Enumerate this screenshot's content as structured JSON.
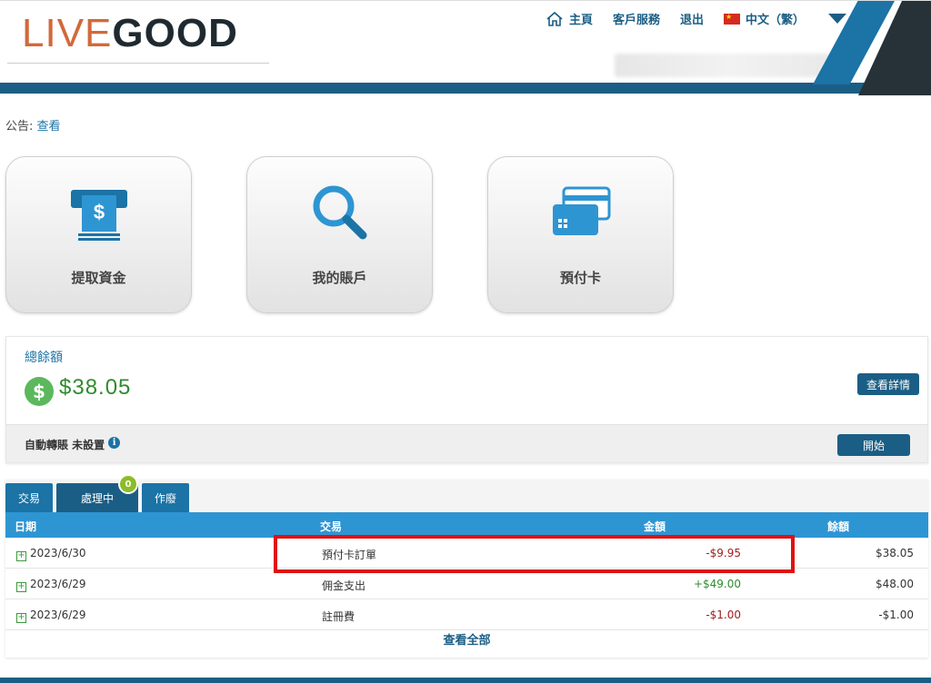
{
  "logo": {
    "part1": "LIVE",
    "part2": "GOOD"
  },
  "nav": {
    "home": "主頁",
    "service": "客戶服務",
    "logout": "退出",
    "language": "中文（繁）"
  },
  "notice": {
    "label": "公告:",
    "link": "查看"
  },
  "tiles": [
    {
      "label": "提取資金",
      "icon": "atm-withdraw-icon"
    },
    {
      "label": "我的賬戶",
      "icon": "magnifier-icon"
    },
    {
      "label": "預付卡",
      "icon": "prepaid-card-icon"
    }
  ],
  "balance": {
    "title": "總餘額",
    "amount": "$38.05",
    "details_button": "查看詳情",
    "auto_transfer_label": "自動轉賬 未設置",
    "start_button": "開始"
  },
  "tabs": [
    {
      "label": "交易"
    },
    {
      "label": "處理中",
      "badge": "0"
    },
    {
      "label": "作廢"
    }
  ],
  "table": {
    "headers": {
      "date": "日期",
      "transaction": "交易",
      "amount": "金額",
      "balance": "餘額"
    },
    "rows": [
      {
        "date": "2023/6/30",
        "transaction": "預付卡訂單",
        "amount": "-$9.95",
        "balance": "$38.05"
      },
      {
        "date": "2023/6/29",
        "transaction": "佣金支出",
        "amount": "+$49.00",
        "balance": "$48.00"
      },
      {
        "date": "2023/6/29",
        "transaction": "註冊費",
        "amount": "-$1.00",
        "balance": "-$1.00"
      }
    ],
    "view_all": "查看全部"
  },
  "colors": {
    "brand_blue": "#1b5e85",
    "header_blue": "#2e95d3",
    "negative": "#a02020",
    "positive": "#2e8b2e",
    "highlight": "#e01010"
  }
}
